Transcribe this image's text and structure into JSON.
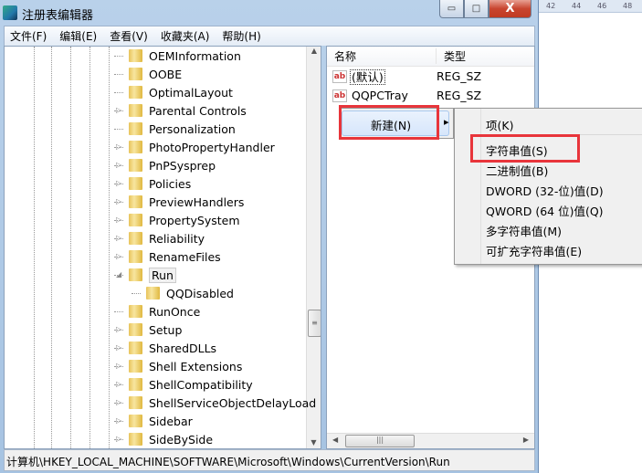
{
  "ruler": {
    "ticks": [
      "42",
      "44",
      "46",
      "48"
    ]
  },
  "window": {
    "title": "注册表编辑器",
    "min": "▭",
    "max": "□",
    "close": "X"
  },
  "menu": [
    "文件(F)",
    "编辑(E)",
    "查看(V)",
    "收藏夹(A)",
    "帮助(H)"
  ],
  "tree": {
    "items": [
      {
        "label": "OEMInformation",
        "expander": "none"
      },
      {
        "label": "OOBE",
        "expander": "none"
      },
      {
        "label": "OptimalLayout",
        "expander": "none"
      },
      {
        "label": "Parental Controls",
        "expander": "collapsed"
      },
      {
        "label": "Personalization",
        "expander": "none"
      },
      {
        "label": "PhotoPropertyHandler",
        "expander": "collapsed"
      },
      {
        "label": "PnPSysprep",
        "expander": "collapsed"
      },
      {
        "label": "Policies",
        "expander": "collapsed"
      },
      {
        "label": "PreviewHandlers",
        "expander": "collapsed"
      },
      {
        "label": "PropertySystem",
        "expander": "collapsed"
      },
      {
        "label": "Reliability",
        "expander": "collapsed"
      },
      {
        "label": "RenameFiles",
        "expander": "collapsed"
      },
      {
        "label": "Run",
        "expander": "expanded",
        "selected": true
      },
      {
        "label": "QQDisabled",
        "expander": "none",
        "child": true
      },
      {
        "label": "RunOnce",
        "expander": "none"
      },
      {
        "label": "Setup",
        "expander": "collapsed"
      },
      {
        "label": "SharedDLLs",
        "expander": "collapsed"
      },
      {
        "label": "Shell Extensions",
        "expander": "collapsed"
      },
      {
        "label": "ShellCompatibility",
        "expander": "collapsed"
      },
      {
        "label": "ShellServiceObjectDelayLoad",
        "expander": "collapsed"
      },
      {
        "label": "Sidebar",
        "expander": "collapsed"
      },
      {
        "label": "SideBySide",
        "expander": "collapsed"
      }
    ],
    "scroll_position": 0.72
  },
  "list": {
    "columns": [
      "名称",
      "类型"
    ],
    "rows": [
      {
        "name": "(默认)",
        "type": "REG_SZ",
        "icon": "string-value-icon"
      },
      {
        "name": "QQPCTray",
        "type": "REG_SZ",
        "icon": "string-value-icon"
      }
    ]
  },
  "context_menu": {
    "new": "新建(N)",
    "arrow": "▸"
  },
  "submenu": [
    "项(K)",
    "字符串值(S)",
    "二进制值(B)",
    "DWORD (32-位)值(D)",
    "QWORD (64 位)值(Q)",
    "多字符串值(M)",
    "可扩充字符串值(E)"
  ],
  "status": "计算机\\HKEY_LOCAL_MACHINE\\SOFTWARE\\Microsoft\\Windows\\CurrentVersion\\Run",
  "colors": {
    "highlight_box": "#e8353b"
  }
}
